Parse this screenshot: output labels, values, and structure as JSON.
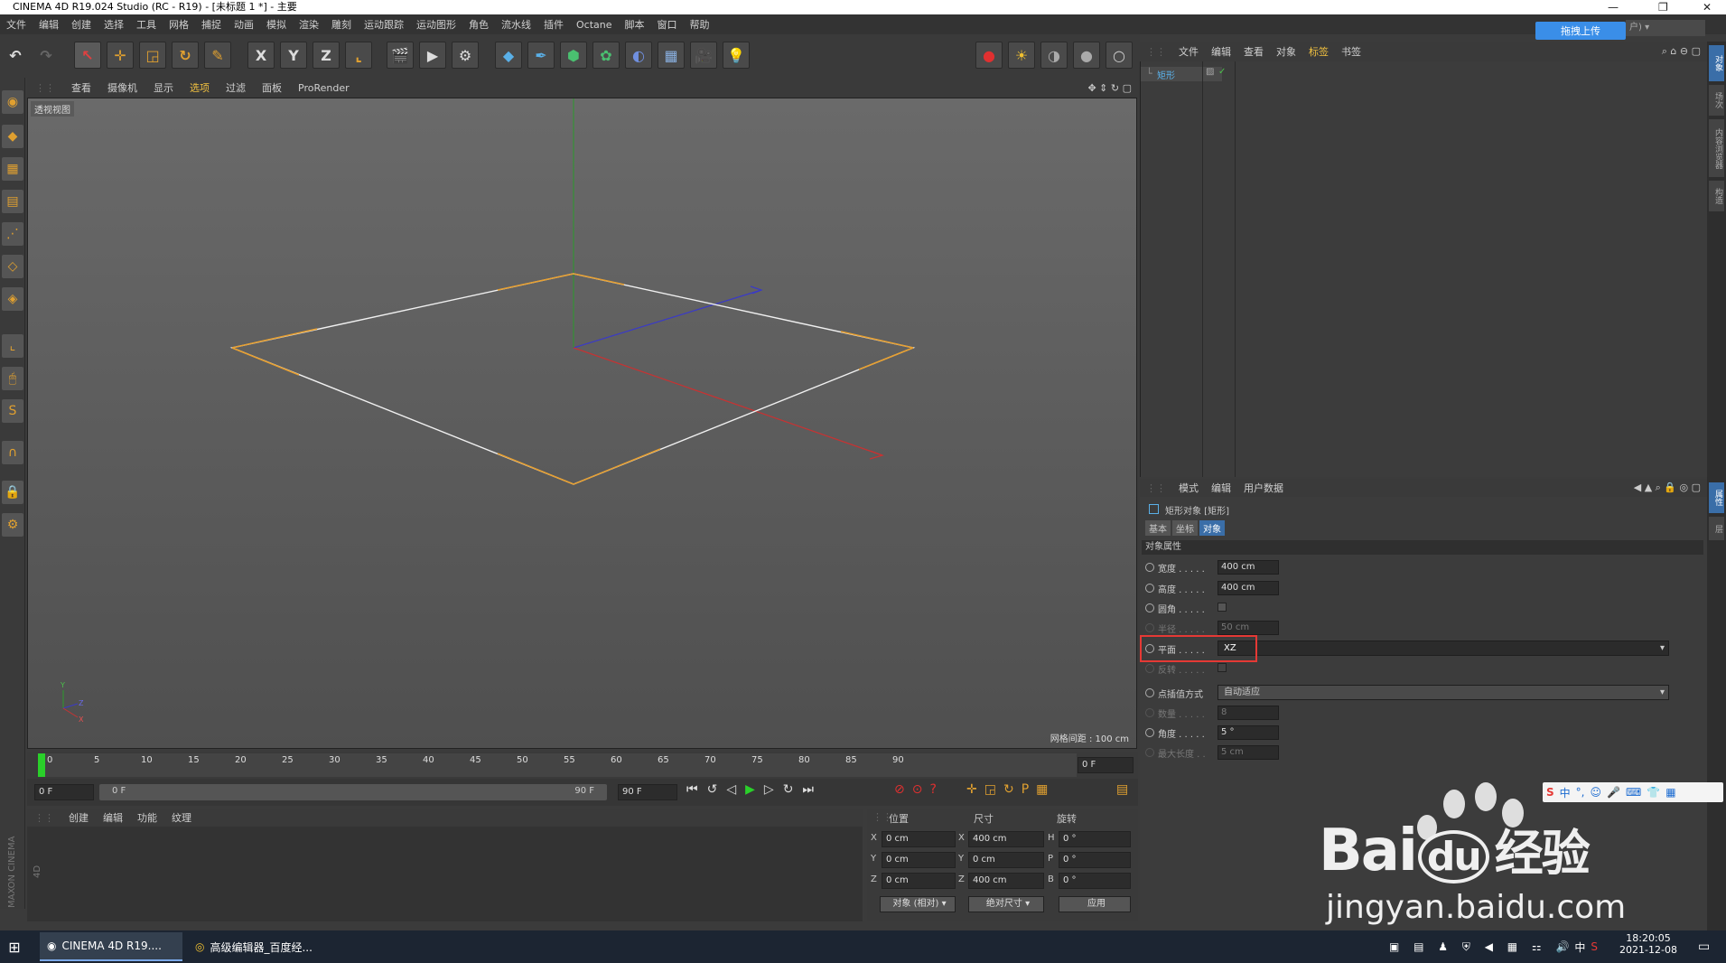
{
  "window": {
    "title": "CINEMA 4D R19.024 Studio (RC - R19) - [未标题 1 *] - 主要"
  },
  "menu": [
    "文件",
    "编辑",
    "创建",
    "选择",
    "工具",
    "网格",
    "捕捉",
    "动画",
    "模拟",
    "渲染",
    "雕刻",
    "运动跟踪",
    "运动图形",
    "角色",
    "流水线",
    "插件",
    "Octane",
    "脚本",
    "窗口",
    "帮助"
  ],
  "upload_button": "拖拽上传",
  "upload_right_text": "户)",
  "viewport": {
    "menu": [
      "查看",
      "摄像机",
      "显示",
      "选项",
      "过滤",
      "面板",
      "ProRender"
    ],
    "label": "透视视图",
    "grid_spacing": "网格间距 : 100 cm",
    "axis_letters": {
      "y": "Y",
      "z": "Z",
      "x": "X"
    }
  },
  "timeline": {
    "ticks": [
      "0",
      "5",
      "10",
      "15",
      "20",
      "25",
      "30",
      "35",
      "40",
      "45",
      "50",
      "55",
      "60",
      "65",
      "70",
      "75",
      "80",
      "85",
      "90"
    ],
    "current_frame": "0 F",
    "start_field": "0 F",
    "range_start": "0 F",
    "range_end": "90 F",
    "end_field": "90 F"
  },
  "toolbar": {
    "axis_x": "X",
    "axis_y": "Y",
    "axis_z": "Z"
  },
  "materials": {
    "menu": [
      "创建",
      "编辑",
      "功能",
      "纹理"
    ],
    "side_label": "MAXON CINEMA 4D"
  },
  "coords": {
    "headers": [
      "位置",
      "尺寸",
      "旋转"
    ],
    "rows": [
      {
        "axis": "X",
        "pos": "0 cm",
        "saxis": "X",
        "size": "400 cm",
        "raxis": "H",
        "rot": "0 °"
      },
      {
        "axis": "Y",
        "pos": "0 cm",
        "saxis": "Y",
        "size": "0 cm",
        "raxis": "P",
        "rot": "0 °"
      },
      {
        "axis": "Z",
        "pos": "0 cm",
        "saxis": "Z",
        "size": "400 cm",
        "raxis": "B",
        "rot": "0 °"
      }
    ],
    "mode1": "对象 (相对)",
    "mode2": "绝对尺寸",
    "apply": "应用"
  },
  "objmgr": {
    "menu": [
      "文件",
      "编辑",
      "查看",
      "对象",
      "标签",
      "书签"
    ],
    "object_name": "矩形"
  },
  "attrmgr": {
    "menu": [
      "模式",
      "编辑",
      "用户数据"
    ],
    "title": "矩形对象 [矩形]",
    "tabs": [
      "基本",
      "坐标",
      "对象"
    ],
    "section": "对象属性",
    "rows": [
      {
        "label": "宽度 . . . . .",
        "value": "400 cm"
      },
      {
        "label": "高度 . . . . .",
        "value": "400 cm"
      },
      {
        "label": "圆角 . . . . .",
        "value": ""
      },
      {
        "label": "半径 . . . . .",
        "value": "50 cm"
      },
      {
        "label": "平面 . . . . .",
        "value": "XZ"
      },
      {
        "label": "反转 . . . . .",
        "value": ""
      },
      {
        "label": "点插值方式",
        "value": "自动适应"
      },
      {
        "label": "数量 . . . . .",
        "value": "8"
      },
      {
        "label": "角度 . . . . .",
        "value": "5 °"
      },
      {
        "label": "最大长度 . .",
        "value": "5 cm"
      }
    ]
  },
  "right_strip": [
    "对象",
    "场次",
    "内容浏览器",
    "构造",
    "属性",
    "层"
  ],
  "taskbar": {
    "app1": "CINEMA 4D R19....",
    "app2": "高级编辑器_百度经...",
    "time": "18:20:05",
    "date": "2021-12-08",
    "ime": "中"
  },
  "watermark": {
    "logo": "Bai",
    "du": "du",
    "jingyan": "经验",
    "url": "jingyan.baidu.com"
  },
  "colors": {
    "highlight": "#e53935",
    "spline_white": "#f0f0f0",
    "spline_orange": "#e8a030",
    "axis_red": "#c83232",
    "axis_blue": "#3a3ac8",
    "axis_green": "#2a9a2a"
  }
}
